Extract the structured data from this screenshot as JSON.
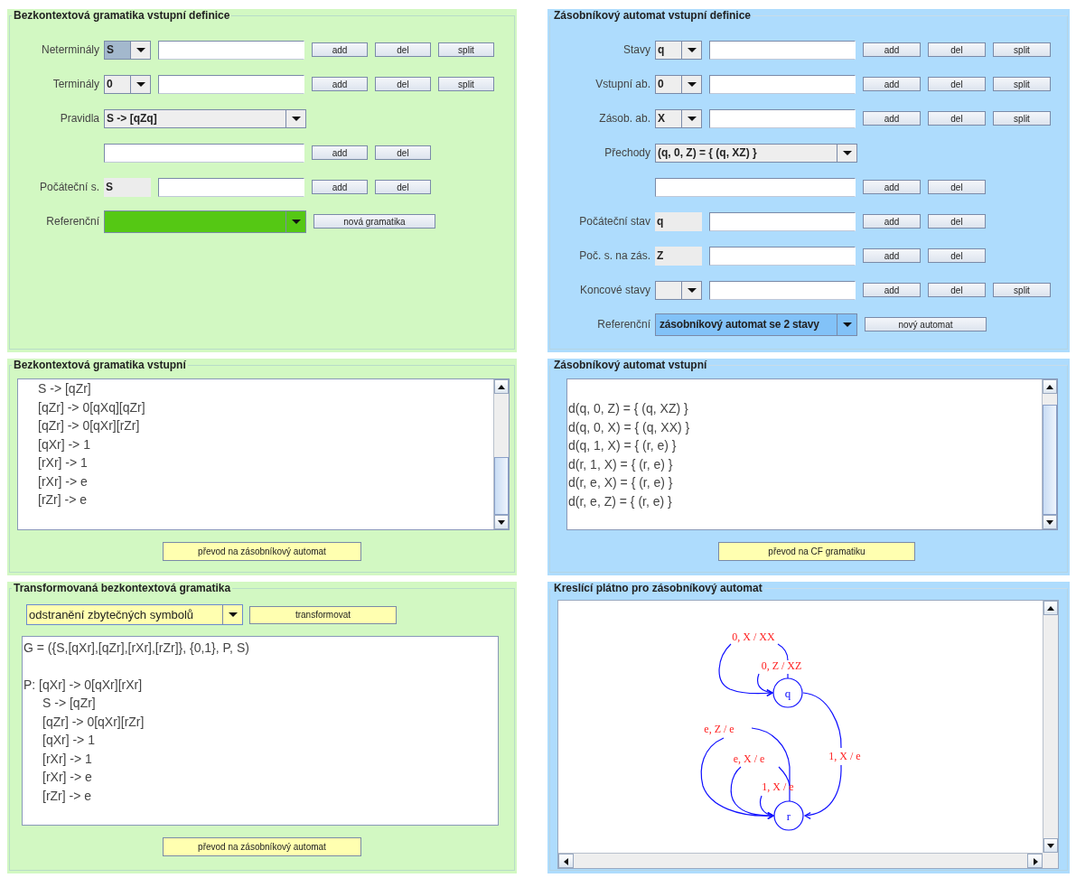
{
  "columns": [
    {
      "kind": "grammar",
      "panels": [
        {
          "kind": "definition",
          "title": "Bezkontextová gramatika vstupní definice",
          "rows": [
            {
              "kind": "list",
              "label": "Neterminály",
              "value": "S",
              "selected": true,
              "buttons": [
                "add",
                "del",
                "split"
              ]
            },
            {
              "kind": "list",
              "label": "Terminály",
              "value": "0",
              "selected": false,
              "buttons": [
                "add",
                "del",
                "split"
              ]
            },
            {
              "kind": "select",
              "label": "Pravidla",
              "value": "S -> [qZq]",
              "selected": false
            },
            {
              "kind": "entry",
              "buttons": [
                "add",
                "del"
              ]
            },
            {
              "kind": "fixed",
              "label": "Počáteční s.",
              "value": "S",
              "buttons": [
                "add",
                "del"
              ]
            },
            {
              "kind": "reference",
              "label": "Referenční",
              "selected": true,
              "buttons": [
                "nová gramatika"
              ]
            }
          ]
        },
        {
          "kind": "text",
          "title": "Bezkontextová gramatika vstupní",
          "sections": [
            [
              {
                "text": "S -> [qZr]",
                "indented": true
              },
              {
                "text": "[qZr] -> 0[qXq][qZr]",
                "indented": true
              },
              {
                "text": "[qZr] -> 0[qXr][rZr]",
                "indented": true
              },
              {
                "text": "[qXr] -> 1",
                "indented": true
              },
              {
                "text": "[rXr] -> 1",
                "indented": true
              },
              {
                "text": "[rXr] -> e",
                "indented": true
              },
              {
                "text": "[rZr] -> e",
                "indented": true
              }
            ]
          ],
          "button": "převod na zásobníkový automat"
        },
        {
          "kind": "transform",
          "title": "Transformovaná bezkontextová gramatika",
          "option": "odstranění zbytečných symbolů",
          "action": "transformovat",
          "sections": [
            [
              {
                "text": "G = ({S,[qXr],[qZr],[rXr],[rZr]}, {0,1}, P, S)",
                "indented": false
              }
            ],
            [
              {
                "text": "P: [qXr] -> 0[qXr][rXr]",
                "indented": false
              },
              {
                "text": "S -> [qZr]",
                "indented": true
              },
              {
                "text": "[qZr] -> 0[qXr][rZr]",
                "indented": true
              },
              {
                "text": "[qXr] -> 1",
                "indented": true
              },
              {
                "text": "[rXr] -> 1",
                "indented": true
              },
              {
                "text": "[rXr] -> e",
                "indented": true
              },
              {
                "text": "[rZr] -> e",
                "indented": true
              }
            ]
          ],
          "button": "převod na zásobníkový automat"
        }
      ]
    },
    {
      "kind": "automaton",
      "panels": [
        {
          "kind": "definition",
          "title": "Zásobníkový automat vstupní definice",
          "rows": [
            {
              "kind": "list",
              "label": "Stavy",
              "value": "q",
              "selected": false,
              "buttons": [
                "add",
                "del",
                "split"
              ]
            },
            {
              "kind": "list",
              "label": "Vstupní ab.",
              "value": "0",
              "selected": false,
              "buttons": [
                "add",
                "del",
                "split"
              ]
            },
            {
              "kind": "list",
              "label": "Zásob. ab.",
              "value": "X",
              "selected": false,
              "buttons": [
                "add",
                "del",
                "split"
              ]
            },
            {
              "kind": "select",
              "label": "Přechody",
              "value": "(q, 0, Z) = { (q, XZ) }",
              "selected": false
            },
            {
              "kind": "entry",
              "buttons": [
                "add",
                "del"
              ]
            },
            {
              "kind": "fixed",
              "label": "Počáteční stav",
              "value": "q",
              "buttons": [
                "add",
                "del"
              ]
            },
            {
              "kind": "fixed",
              "label": "Poč. s. na zás.",
              "value": "Z",
              "buttons": [
                "add",
                "del"
              ]
            },
            {
              "kind": "list",
              "label": "Koncové stavy",
              "selected": false,
              "buttons": [
                "add",
                "del",
                "split"
              ]
            },
            {
              "kind": "reference",
              "label": "Referenční",
              "value": "zásobníkový automat se 2 stavy",
              "selected": true,
              "buttons": [
                "nový automat"
              ]
            }
          ]
        },
        {
          "kind": "text",
          "title": "Zásobníkový automat vstupní",
          "sections": [
            [
              {
                "text": "d(q, 0, Z) = { (q, XZ) }",
                "indented": false
              },
              {
                "text": "d(q, 0, X) = { (q, XX) }",
                "indented": false
              },
              {
                "text": "d(q, 1, X) = { (r, e) }",
                "indented": false
              },
              {
                "text": "d(r, 1, X) = { (r, e) }",
                "indented": false
              },
              {
                "text": "d(r, e, X) = { (r, e) }",
                "indented": false
              },
              {
                "text": "d(r, e, Z) = { (r, e) }",
                "indented": false
              }
            ]
          ],
          "button": "převod na CF gramatiku"
        },
        {
          "kind": "canvas",
          "title": "Kreslící plátno pro zásobníkový automat",
          "states": [
            {
              "name": "q"
            },
            {
              "name": "r"
            }
          ],
          "transitions": [
            {
              "label": "0, X / XX"
            },
            {
              "label": "0, Z / XZ"
            },
            {
              "label": "e, Z / e"
            },
            {
              "label": "e, X / e"
            },
            {
              "label": "1, X / e"
            },
            {
              "label": "1, X / e"
            }
          ]
        }
      ]
    }
  ]
}
